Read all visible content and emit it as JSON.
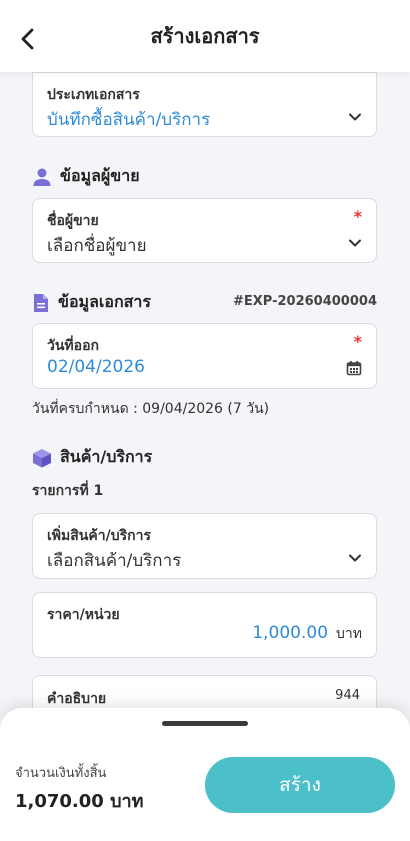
{
  "header": {
    "title": "สร้างเอกสาร"
  },
  "doc_type": {
    "label": "ประเภทเอกสาร",
    "value": "บันทึกซื้อสินค้า/บริการ"
  },
  "seller_section": {
    "title": "ข้อมูลผู้ขาย"
  },
  "seller": {
    "label": "ชื่อผู้ขาย",
    "required_mark": "*",
    "placeholder": "เลือกชื่อผู้ขาย"
  },
  "doc_section": {
    "title": "ข้อมูลเอกสาร",
    "doc_number": "#EXP-20260400004"
  },
  "issue_date": {
    "label": "วันที่ออก",
    "required_mark": "*",
    "value": "02/04/2026"
  },
  "due_text": "วันที่ครบกำหนด : 09/04/2026 (7 วัน)",
  "product_section": {
    "title": "สินค้า/บริการ",
    "item_label": "รายการที่ 1"
  },
  "add_product": {
    "label": "เพิ่มสินค้า/บริการ",
    "placeholder": "เลือกสินค้า/บริการ"
  },
  "price": {
    "label": "ราคา/หน่วย",
    "value": "1,000.00",
    "unit": "บาท"
  },
  "description": {
    "label": "คำอธิบาย",
    "char_count": "944"
  },
  "footer": {
    "total_label": "จำนวนเงินทั้งสิ้น",
    "total_value": "1,070.00 บาท",
    "create_label": "สร้าง"
  },
  "colors": {
    "accent": "#4bc0c8",
    "link_blue": "#2e8bd9",
    "icon_purple": "#7b6fd6",
    "required": "#e53935"
  },
  "icons": [
    "back-arrow-icon",
    "chevron-down-icon",
    "user-icon",
    "document-icon",
    "calendar-icon",
    "box-icon"
  ]
}
